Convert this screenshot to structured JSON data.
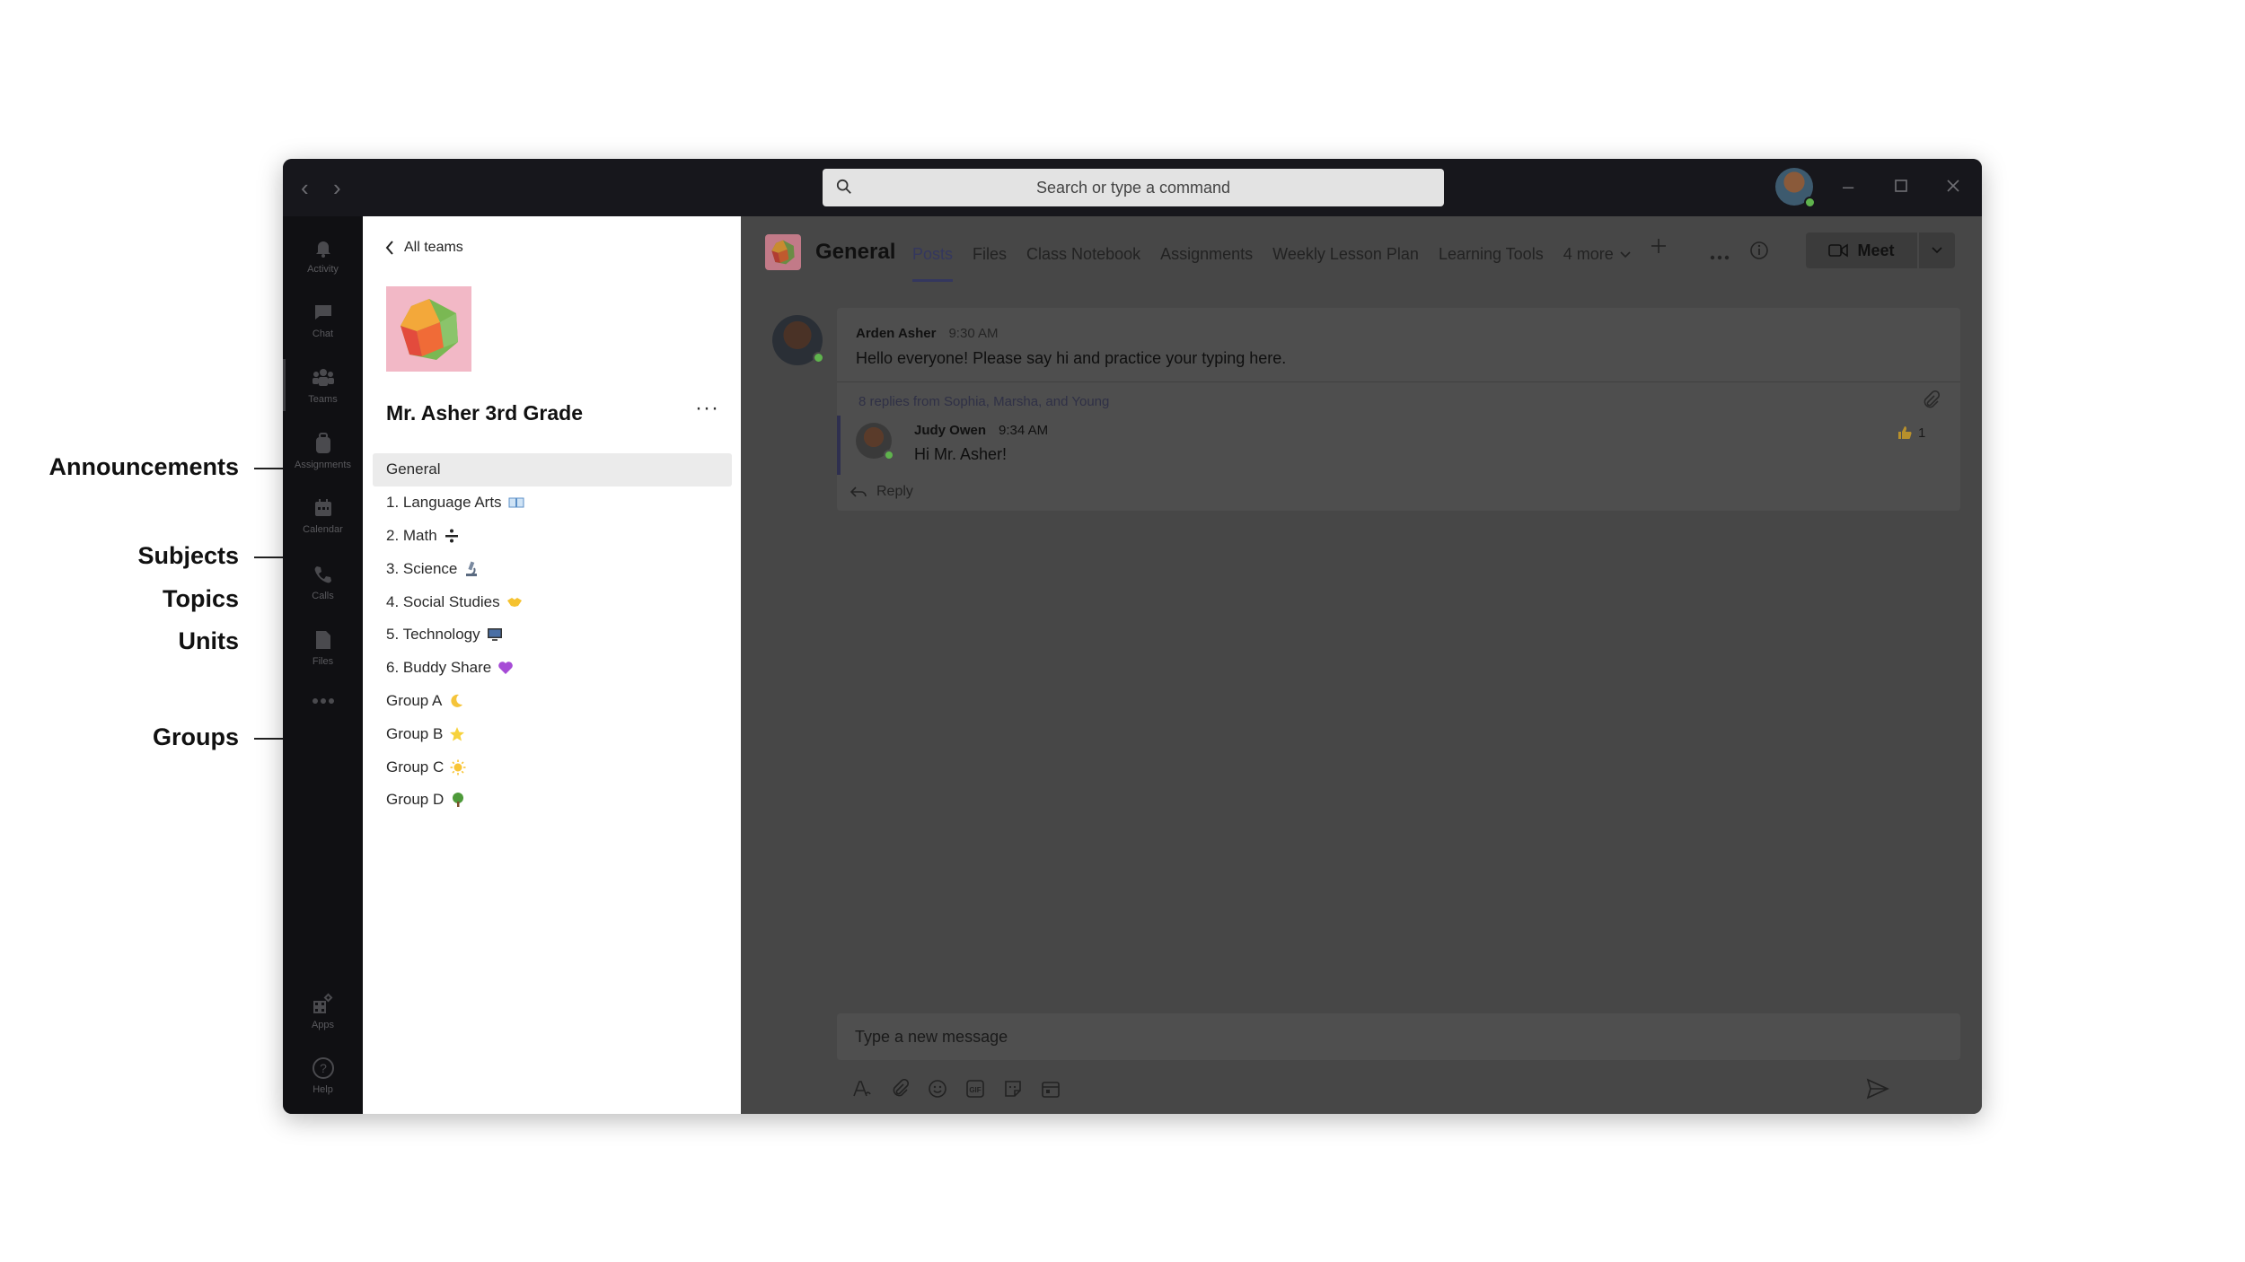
{
  "annotations": [
    "Announcements",
    "Subjects",
    "Topics",
    "Units",
    "Groups"
  ],
  "titlebar": {
    "search_placeholder": "Search or type a command"
  },
  "rail": {
    "items": [
      "Activity",
      "Chat",
      "Teams",
      "Assignments",
      "Calendar",
      "Calls",
      "Files"
    ],
    "bottom_items": [
      "Apps",
      "Help"
    ]
  },
  "panel": {
    "back_label": "All teams",
    "team_name": "Mr. Asher 3rd Grade",
    "channels": [
      {
        "label": "General",
        "emoji": ""
      },
      {
        "label": "1. Language Arts",
        "emoji": "book"
      },
      {
        "label": "2. Math",
        "emoji": "divide"
      },
      {
        "label": "3. Science",
        "emoji": "microscope"
      },
      {
        "label": "4. Social Studies",
        "emoji": "handshake"
      },
      {
        "label": "5. Technology",
        "emoji": "computer"
      },
      {
        "label": "6. Buddy Share",
        "emoji": "purple-heart"
      },
      {
        "label": "Group A",
        "emoji": "moon"
      },
      {
        "label": "Group B",
        "emoji": "star"
      },
      {
        "label": "Group C",
        "emoji": "sun"
      },
      {
        "label": "Group D",
        "emoji": "tree"
      }
    ]
  },
  "header": {
    "channel_title": "General",
    "tabs": [
      "Posts",
      "Files",
      "Class Notebook",
      "Assignments",
      "Weekly Lesson Plan",
      "Learning Tools",
      "4 more"
    ],
    "meet_label": "Meet"
  },
  "post": {
    "author": "Arden Asher",
    "time": "9:30 AM",
    "text": "Hello everyone! Please say hi and practice your typing here.",
    "replies_summary": "8 replies from Sophia, Marsha, and Young",
    "reply": {
      "author": "Judy Owen",
      "time": "9:34 AM",
      "text": "Hi Mr. Asher!",
      "reaction_count": "1"
    },
    "reply_label": "Reply"
  },
  "compose": {
    "placeholder": "Type a new message"
  },
  "colors": {
    "accent": "#34375e",
    "presence": "#5fb34d",
    "titlebar": "#17171c",
    "rail": "#101013"
  }
}
